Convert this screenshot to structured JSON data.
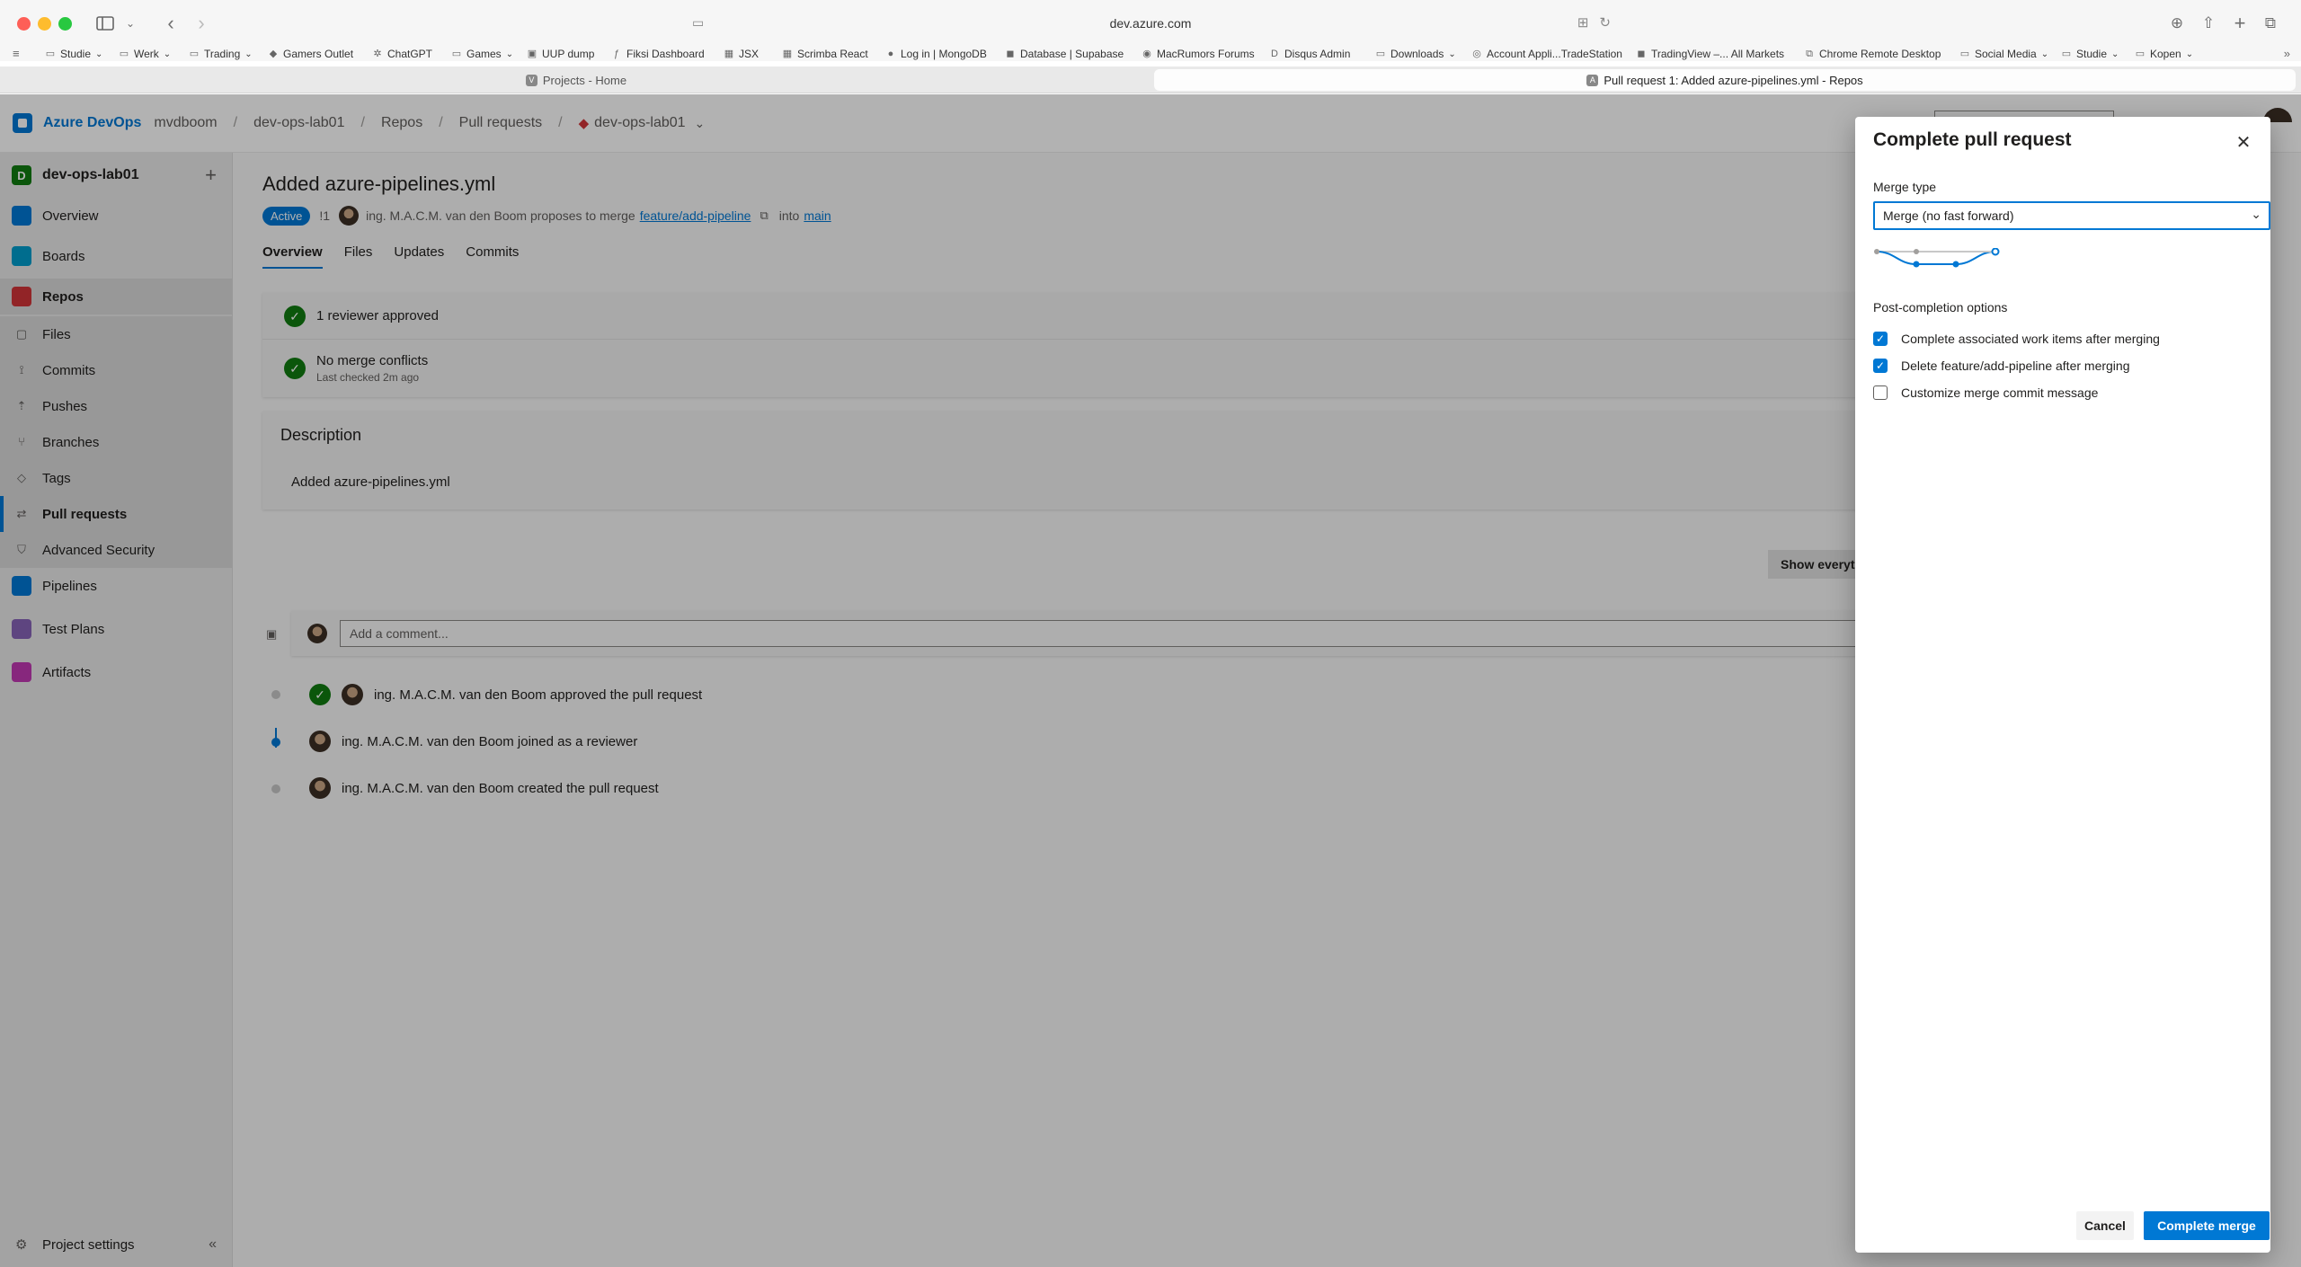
{
  "browser": {
    "url": "dev.azure.com",
    "bookmarks": [
      {
        "label": "Studie",
        "icon": "folder-icon",
        "menu": true
      },
      {
        "label": "Werk",
        "icon": "folder-icon",
        "menu": true
      },
      {
        "label": "Trading",
        "icon": "folder-icon",
        "menu": true
      },
      {
        "label": "Gamers Outlet",
        "icon": "gamers-outlet-icon",
        "menu": false
      },
      {
        "label": "ChatGPT",
        "icon": "chatgpt-icon",
        "menu": false
      },
      {
        "label": "Games",
        "icon": "folder-icon",
        "menu": true
      },
      {
        "label": "UUP dump",
        "icon": "uup-icon",
        "menu": false
      },
      {
        "label": "Fiksi Dashboard",
        "icon": "fiksi-icon",
        "menu": false
      },
      {
        "label": "JSX",
        "icon": "jsx-icon",
        "menu": false
      },
      {
        "label": "Scrimba React",
        "icon": "scrimba-icon",
        "menu": false
      },
      {
        "label": "Log in | MongoDB",
        "icon": "mongodb-icon",
        "menu": false
      },
      {
        "label": "Database | Supabase",
        "icon": "supabase-icon",
        "menu": false
      },
      {
        "label": "MacRumors Forums",
        "icon": "macrumors-icon",
        "menu": false
      },
      {
        "label": "Disqus Admin",
        "icon": "disqus-icon",
        "menu": false
      },
      {
        "label": "Downloads",
        "icon": "folder-icon",
        "menu": true
      },
      {
        "label": "Account Appli...TradeStation",
        "icon": "globe-icon",
        "menu": false
      },
      {
        "label": "TradingView –... All Markets",
        "icon": "tradingview-icon",
        "menu": false
      },
      {
        "label": "Chrome Remote Desktop",
        "icon": "remote-desktop-icon",
        "menu": false
      },
      {
        "label": "Social Media",
        "icon": "folder-icon",
        "menu": true
      },
      {
        "label": "Studie",
        "icon": "folder-icon",
        "menu": true
      },
      {
        "label": "Kopen",
        "icon": "folder-icon",
        "menu": true
      }
    ],
    "tabs": [
      {
        "label": "Projects - Home",
        "active": false
      },
      {
        "label": "Pull request 1: Added azure-pipelines.yml - Repos",
        "active": true
      }
    ]
  },
  "header": {
    "brand": "Azure DevOps",
    "org": "mvdboom",
    "project": "dev-ops-lab01",
    "section": "Repos",
    "page": "Pull requests",
    "repo": "dev-ops-lab01"
  },
  "sidebar": {
    "project_initial": "D",
    "project_name": "dev-ops-lab01",
    "items": [
      {
        "label": "Overview",
        "icon": "overview-icon"
      },
      {
        "label": "Boards",
        "icon": "boards-icon"
      },
      {
        "label": "Repos",
        "icon": "repos-icon"
      },
      {
        "label": "Files",
        "icon": "file-icon"
      },
      {
        "label": "Commits",
        "icon": "commit-icon"
      },
      {
        "label": "Pushes",
        "icon": "push-icon"
      },
      {
        "label": "Branches",
        "icon": "branch-icon"
      },
      {
        "label": "Tags",
        "icon": "tag-icon"
      },
      {
        "label": "Pull requests",
        "icon": "pull-request-icon"
      },
      {
        "label": "Advanced Security",
        "icon": "shield-icon"
      },
      {
        "label": "Pipelines",
        "icon": "pipelines-icon"
      },
      {
        "label": "Test Plans",
        "icon": "test-plans-icon"
      },
      {
        "label": "Artifacts",
        "icon": "artifacts-icon"
      }
    ],
    "footer": "Project settings"
  },
  "pr": {
    "title": "Added azure-pipelines.yml",
    "status": "Active",
    "number": "!1",
    "author_text": "ing. M.A.C.M. van den Boom proposes to merge",
    "source_branch": "feature/add-pipeline",
    "into": "into",
    "target_branch": "main",
    "tabs": [
      "Overview",
      "Files",
      "Updates",
      "Commits"
    ],
    "checks": [
      {
        "title": "1 reviewer approved",
        "sub": ""
      },
      {
        "title": "No merge conflicts",
        "sub": "Last checked 2m ago"
      }
    ],
    "description_title": "Description",
    "description_body": "Added azure-pipelines.yml",
    "show_everything": "Show everyt",
    "comment_placeholder": "Add a comment...",
    "timeline": [
      "ing. M.A.C.M. van den Boom approved the pull request",
      "ing. M.A.C.M. van den Boom joined as a reviewer",
      "ing. M.A.C.M. van den Boom created the pull request"
    ]
  },
  "dialog": {
    "title": "Complete pull request",
    "merge_type_label": "Merge type",
    "merge_type_value": "Merge (no fast forward)",
    "post_label": "Post-completion options",
    "options": [
      {
        "label": "Complete associated work items after merging",
        "checked": true
      },
      {
        "label": "Delete feature/add-pipeline after merging",
        "checked": true
      },
      {
        "label": "Customize merge commit message",
        "checked": false
      }
    ],
    "cancel": "Cancel",
    "complete": "Complete merge"
  },
  "colors": {
    "accent": "#0078d4",
    "success": "#107c10"
  }
}
